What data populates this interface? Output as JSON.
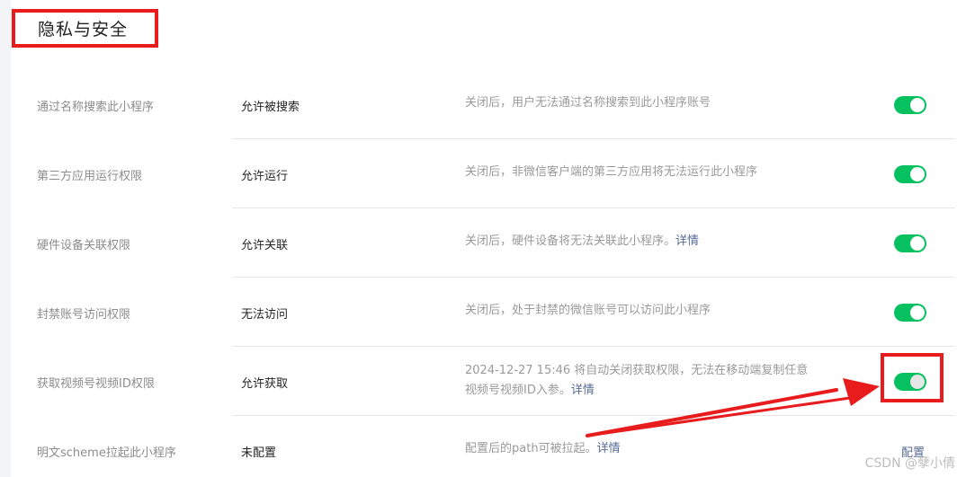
{
  "section": {
    "title": "隐私与安全"
  },
  "rows": [
    {
      "label": "通过名称搜索此小程序",
      "value": "允许被搜索",
      "desc": "关闭后，用户无法通过名称搜索到此小程序账号",
      "link": "",
      "toggle": "on"
    },
    {
      "label": "第三方应用运行权限",
      "value": "允许运行",
      "desc": "关闭后，非微信客户端的第三方应用将无法运行此小程序",
      "link": "",
      "toggle": "on"
    },
    {
      "label": "硬件设备关联权限",
      "value": "允许关联",
      "desc": "关闭后，硬件设备将无法关联此小程序。",
      "link": "详情",
      "toggle": "on"
    },
    {
      "label": "封禁账号访问权限",
      "value": "无法访问",
      "desc": "关闭后，处于封禁的微信账号可以访问此小程序",
      "link": "",
      "toggle": "on"
    },
    {
      "label": "获取视频号视频ID权限",
      "value": "允许获取",
      "desc_line1": "2024-12-27 15:46 将自动关闭获取权限，无法在移动端复制任意",
      "desc_line2": "视频号视频ID入参。",
      "link": "详情",
      "toggle": "on"
    },
    {
      "label": "明文scheme拉起此小程序",
      "value": "未配置",
      "desc": "配置后的path可被拉起。",
      "link": "详情",
      "action": "配置"
    }
  ],
  "watermark": "CSDN @孽小倩",
  "colors": {
    "toggle_on": "#07c160",
    "link": "#576b95",
    "highlight": "#e81c1c"
  }
}
